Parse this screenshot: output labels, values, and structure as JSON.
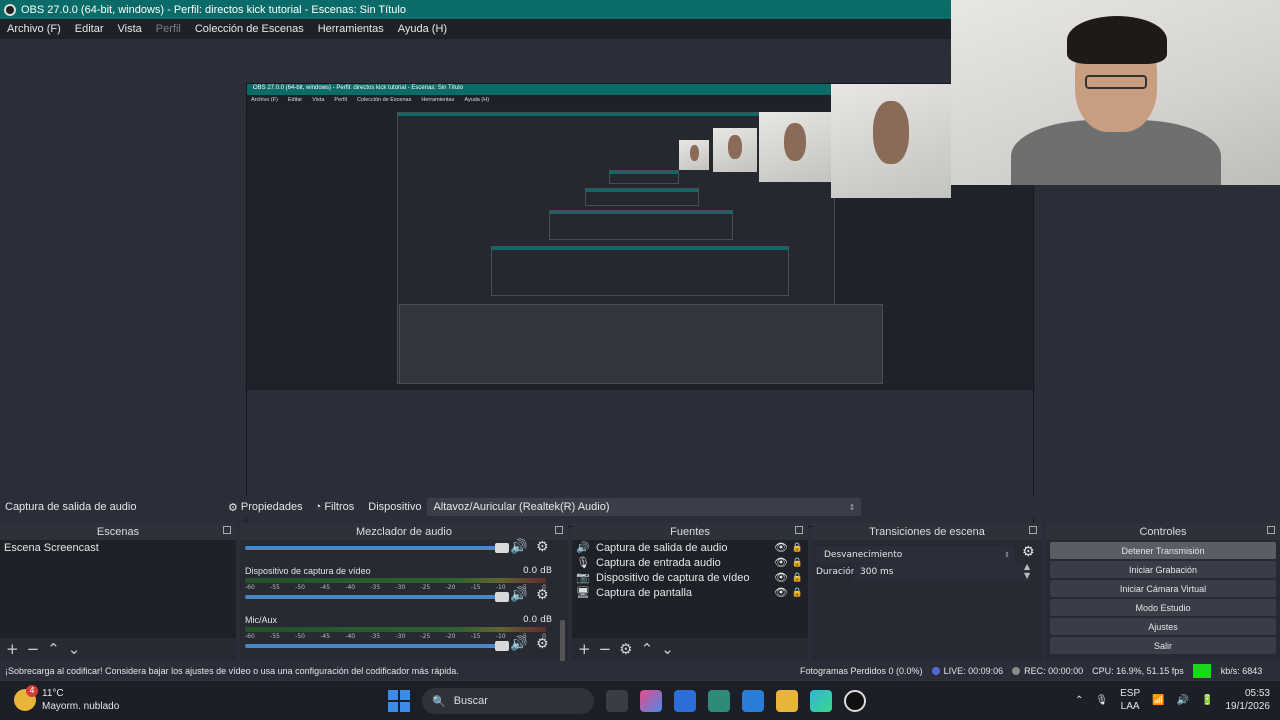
{
  "window": {
    "title": "OBS 27.0.0 (64-bit, windows) - Perfil: directos kick tutorial - Escenas: Sin Título"
  },
  "menu": [
    {
      "label": "Archivo (F)",
      "disabled": false
    },
    {
      "label": "Editar",
      "disabled": false
    },
    {
      "label": "Vista",
      "disabled": false
    },
    {
      "label": "Perfil",
      "disabled": true
    },
    {
      "label": "Colección de Escenas",
      "disabled": false
    },
    {
      "label": "Herramientas",
      "disabled": false
    },
    {
      "label": "Ayuda (H)",
      "disabled": false
    }
  ],
  "properties_bar": {
    "source_name": "Captura de salida de audio",
    "properties_label": "Propiedades",
    "filters_label": "Filtros",
    "device_label": "Dispositivo",
    "device_value": "Altavoz/Auricular (Realtek(R) Audio)"
  },
  "scenes": {
    "title": "Escenas",
    "items": [
      "Escena Screencast"
    ]
  },
  "mixer": {
    "title": "Mezclador de audio",
    "channels": [
      {
        "name": "",
        "db": ""
      },
      {
        "name": "Dispositivo de captura de vídeo",
        "db": "0.0 dB"
      },
      {
        "name": "Mic/Aux",
        "db": "0.0 dB"
      }
    ],
    "ticks": [
      "-60",
      "-55",
      "-50",
      "-45",
      "-40",
      "-35",
      "-30",
      "-25",
      "-20",
      "-15",
      "-10",
      "-5",
      "0"
    ]
  },
  "sources": {
    "title": "Fuentes",
    "items": [
      {
        "label": "Captura de salida de audio",
        "icon": "speaker-icon"
      },
      {
        "label": "Captura de entrada audio",
        "icon": "microphone-icon"
      },
      {
        "label": "Dispositivo de captura de vídeo",
        "icon": "camera-icon"
      },
      {
        "label": "Captura de pantalla",
        "icon": "monitor-icon"
      }
    ]
  },
  "transitions": {
    "title": "Transiciones de escena",
    "selected": "Desvanecimiento",
    "duration_label": "Duración",
    "duration_value": "300 ms"
  },
  "controls": {
    "title": "Controles",
    "buttons": [
      "Detener Transmisión",
      "Iniciar Grabación",
      "Iniciar Cámara Virtual",
      "Modo Estudio",
      "Ajustes",
      "Salir"
    ]
  },
  "status": {
    "warning": "¡Sobrecarga al codificar! Considera bajar los ajustes de vídeo o usa una configuración del codificador más rápida.",
    "dropped_frames": "Fotogramas Perdidos 0 (0.0%)",
    "live": "LIVE: 00:09:06",
    "rec": "REC: 00:00:00",
    "cpu": "CPU: 16.9%, 51.15 fps",
    "kbps": "kb/s: 6843",
    "live_color": "#4f6bd8",
    "rec_color": "#8a8a8a",
    "health_color": "#18d818"
  },
  "taskbar": {
    "weather_badge": "4",
    "temperature": "11°C",
    "condition": "Mayorm. nublado",
    "search_placeholder": "Buscar",
    "language": "ESP",
    "language_sub": "LAA",
    "time": "05:53",
    "date": "19/1/2026"
  },
  "nested_preview": {
    "title": "OBS 27.0.0 (64-bit, windows) - Perfil: directos kick tutorial - Escenas: Sin Título",
    "menu": [
      "Archivo (F)",
      "Editar",
      "Vista",
      "Perfil",
      "Colección de Escenas",
      "Herramientas",
      "Ayuda (H)"
    ]
  }
}
